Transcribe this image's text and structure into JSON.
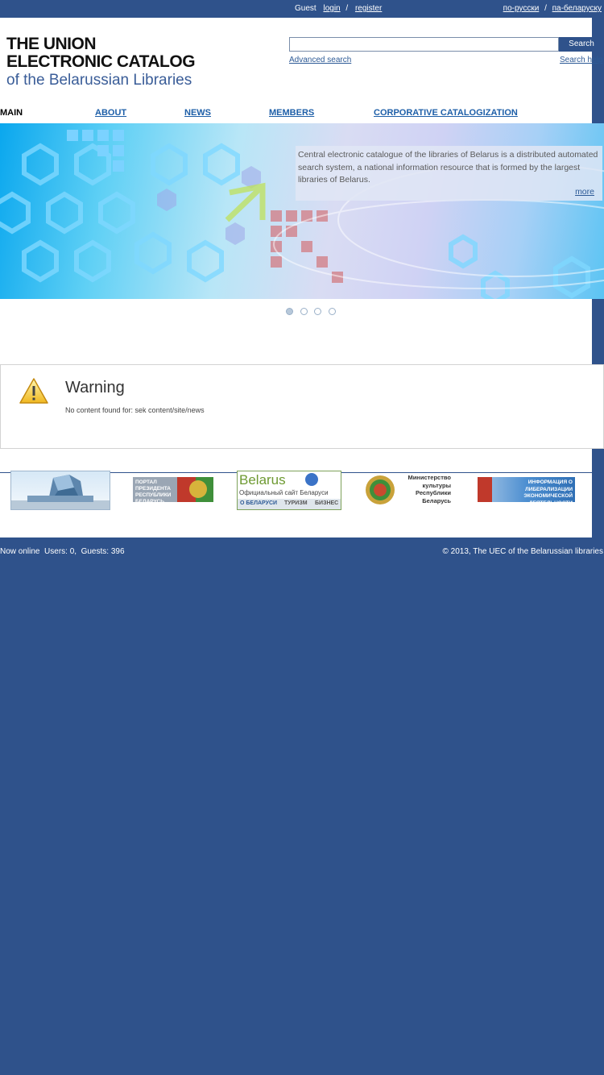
{
  "topbar": {
    "guest": "Guest",
    "login": "login",
    "slash": "/",
    "register": "register",
    "lang_ru": "по-русски",
    "lang_by": "па-беларуску"
  },
  "logo": {
    "line1": "THE UNION",
    "line2": "ELECTRONIC CATALOG",
    "line3": "of the Belarussian Libraries"
  },
  "search": {
    "button": "Search",
    "advanced": "Advanced search",
    "help": "Search help"
  },
  "nav": {
    "items": [
      "MAIN",
      "ABOUT",
      "NEWS",
      "MEMBERS",
      "CORPORATIVE CATALOGIZATION"
    ]
  },
  "banner": {
    "text": "Central electronic catalogue of the libraries of Belarus is a distributed automated search system, a national information resource that is formed by the largest libraries of Belarus.",
    "more": "more",
    "active_slide": 1,
    "slide_count": 4
  },
  "warning": {
    "title": "Warning",
    "message": "No content found for: sek content/site/news"
  },
  "partners": {
    "president_portal": "ПОРТАЛ ПРЕЗИДЕНТА РЕСПУБЛИКИ БЕЛАРУСЬ",
    "belarus_by_title": "Belarus",
    "belarus_by_sub": "Официальный сайт Беларуси",
    "belarus_by_links": [
      "О БЕЛАРУСИ",
      "ТУРИЗМ",
      "БИЗНЕС"
    ],
    "ministry": "Министерство культуры Республики Беларусь",
    "liberalization": "ИНФОРМАЦИЯ О ЛИБЕРАЛИЗАЦИИ ЭКОНОМИЧЕСКОЙ ДЕЯТЕЛЬНОСТИ"
  },
  "footer": {
    "online": "Now online  Users: 0,  Guests: 396",
    "copyright": "© 2013, The UEC of the Belarussian libraries"
  },
  "colors": {
    "primary": "#2f528b",
    "link": "#1e5fa8"
  }
}
